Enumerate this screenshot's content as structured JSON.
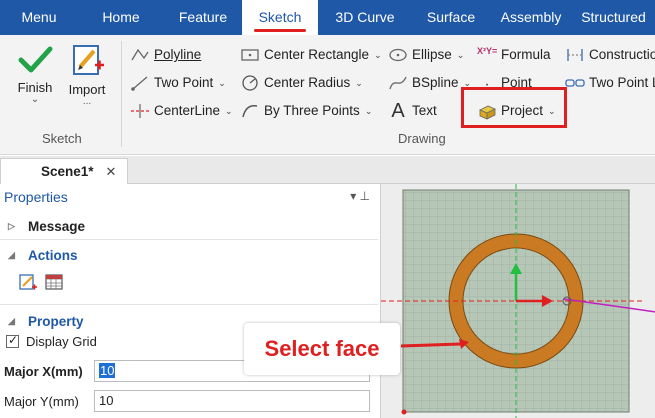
{
  "menubar": {
    "tabs": [
      {
        "label": "Menu"
      },
      {
        "label": "Home"
      },
      {
        "label": "Feature"
      },
      {
        "label": "Sketch"
      },
      {
        "label": "3D Curve"
      },
      {
        "label": "Surface"
      },
      {
        "label": "Assembly"
      },
      {
        "label": "Structured"
      }
    ],
    "active": "Sketch"
  },
  "ribbon": {
    "sketch_group": {
      "finish_label": "Finish",
      "import_label": "Import",
      "import_sub": "...",
      "group_label": "Sketch"
    },
    "drawing_group": {
      "group_label": "Drawing",
      "polyline": "Polyline",
      "two_point": "Two Point",
      "centerline": "CenterLine",
      "center_rectangle": "Center Rectangle",
      "center_radius": "Center Radius",
      "by_three_points": "By Three Points",
      "ellipse": "Ellipse",
      "bspline": "BSpline",
      "text": "Text",
      "formula": "Formula",
      "point": "Point",
      "project": "Project",
      "construction": "Constructio",
      "two_point_l": "Two Point L"
    }
  },
  "doc_tab": {
    "label": "Scene1*",
    "close": "✕"
  },
  "properties": {
    "title": "Properties",
    "pin": "▾  ⊥",
    "message": "Message",
    "actions": "Actions",
    "property": "Property",
    "display_grid": "Display Grid",
    "major_x_label": "Major X(mm)",
    "major_x_value": "10",
    "major_y_label": "Major Y(mm)",
    "major_y_value": "10"
  },
  "callout": {
    "text": "Select face"
  },
  "colors": {
    "menubar": "#1e58a6",
    "highlight_red": "#e02020",
    "ring_fill": "#c97a22",
    "grid_bg": "#b6c7b8"
  }
}
